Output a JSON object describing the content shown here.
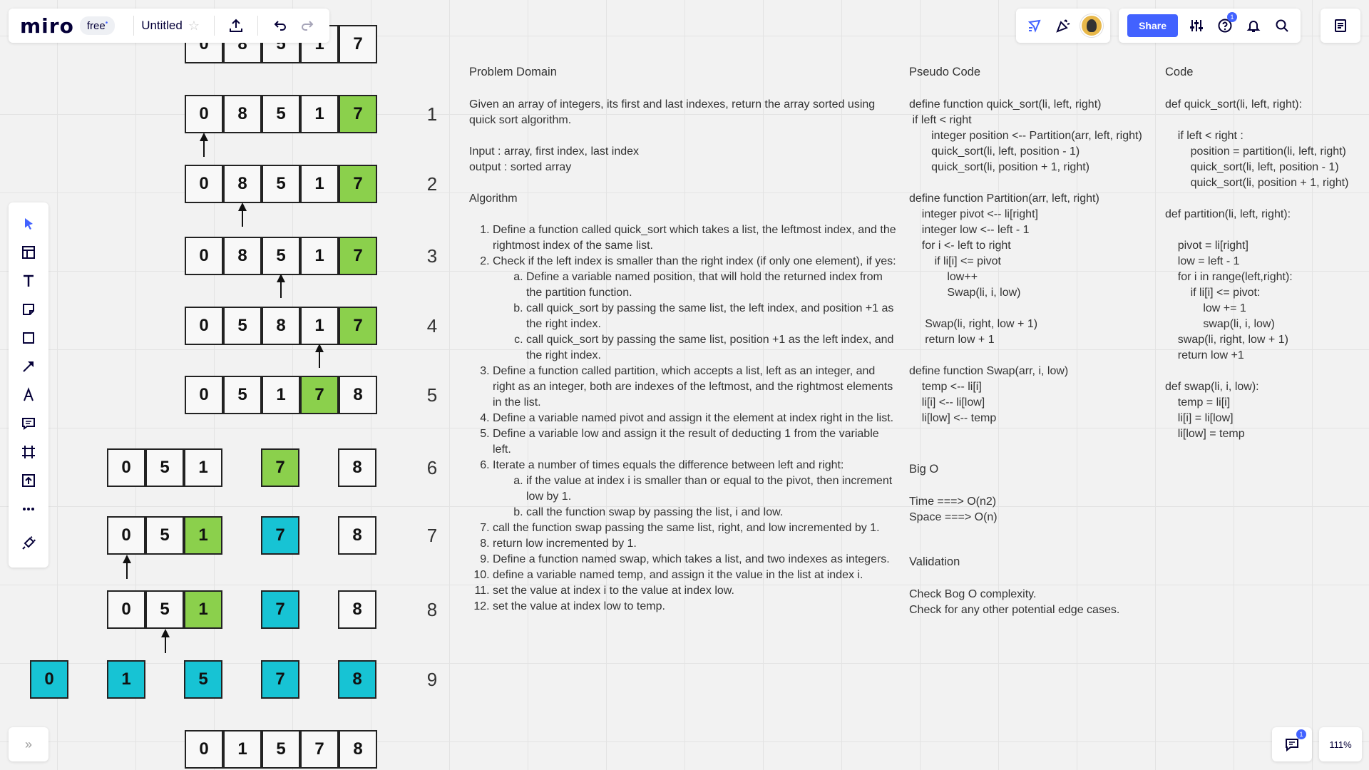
{
  "app": {
    "logo": "miro",
    "plan": "free",
    "plan_marker": "•",
    "board_title": "Untitled",
    "share_label": "Share",
    "help_badge": "1",
    "chat_badge": "1",
    "zoom": "111%"
  },
  "toolbar": {
    "tools": [
      {
        "name": "select-tool",
        "icon": "cursor-icon"
      },
      {
        "name": "templates-tool",
        "icon": "template-icon"
      },
      {
        "name": "text-tool",
        "icon": "text-icon"
      },
      {
        "name": "sticky-note-tool",
        "icon": "sticky-note-icon"
      },
      {
        "name": "shape-tool",
        "icon": "square-icon"
      },
      {
        "name": "connector-tool",
        "icon": "arrow-icon"
      },
      {
        "name": "pen-tool",
        "icon": "pen-icon"
      },
      {
        "name": "comment-tool",
        "icon": "comment-icon"
      },
      {
        "name": "frame-tool",
        "icon": "frame-icon"
      },
      {
        "name": "upload-tool",
        "icon": "upload-icon"
      },
      {
        "name": "more-tool",
        "icon": "more-icon"
      },
      {
        "name": "apps-tool",
        "icon": "plug-icon"
      }
    ]
  },
  "colors": {
    "accent": "#4262ff",
    "pivot_green": "#8bd04c",
    "sorted_cyan": "#17c3d4"
  },
  "diagram": {
    "steps": [
      {
        "label": "",
        "values": [
          "0",
          "8",
          "5",
          "1",
          "7"
        ],
        "highlight": []
      },
      {
        "label": "1",
        "values": [
          "0",
          "8",
          "5",
          "1",
          "7"
        ],
        "highlight": [
          {
            "i": 4,
            "c": "green"
          }
        ]
      },
      {
        "label": "2",
        "values": [
          "0",
          "8",
          "5",
          "1",
          "7"
        ],
        "highlight": [
          {
            "i": 4,
            "c": "green"
          }
        ]
      },
      {
        "label": "3",
        "values": [
          "0",
          "8",
          "5",
          "1",
          "7"
        ],
        "highlight": [
          {
            "i": 4,
            "c": "green"
          }
        ]
      },
      {
        "label": "4",
        "values": [
          "0",
          "5",
          "8",
          "1",
          "7"
        ],
        "highlight": [
          {
            "i": 4,
            "c": "green"
          }
        ]
      },
      {
        "label": "5",
        "values": [
          "0",
          "5",
          "1",
          "7",
          "8"
        ],
        "highlight": [
          {
            "i": 3,
            "c": "green"
          }
        ]
      },
      {
        "label": "6",
        "values": [
          "0",
          "5",
          "1",
          "7",
          "8"
        ],
        "highlight": [
          {
            "i": 3,
            "c": "green"
          }
        ]
      },
      {
        "label": "7",
        "values": [
          "0",
          "5",
          "1",
          "7",
          "8"
        ],
        "highlight": [
          {
            "i": 2,
            "c": "green"
          },
          {
            "i": 3,
            "c": "cyan"
          }
        ]
      },
      {
        "label": "8",
        "values": [
          "0",
          "5",
          "1",
          "7",
          "8"
        ],
        "highlight": [
          {
            "i": 2,
            "c": "green"
          },
          {
            "i": 3,
            "c": "cyan"
          }
        ]
      },
      {
        "label": "9",
        "values": [
          "0",
          "1",
          "5",
          "7",
          "8"
        ],
        "highlight": [
          {
            "i": 0,
            "c": "cyan"
          },
          {
            "i": 1,
            "c": "cyan"
          },
          {
            "i": 2,
            "c": "cyan"
          },
          {
            "i": 3,
            "c": "cyan"
          },
          {
            "i": 4,
            "c": "cyan"
          }
        ]
      },
      {
        "label": "",
        "values": [
          "0",
          "1",
          "5",
          "7",
          "8"
        ],
        "highlight": []
      }
    ]
  },
  "problem": {
    "heading": "Problem Domain",
    "desc": "Given an array of integers, its first and last indexes, return the array sorted using quick sort algorithm.",
    "input": "Input : array, first index, last index",
    "output": "output : sorted array",
    "algorithm_heading": "Algorithm",
    "steps": [
      "Define a function called quick_sort which takes a list, the leftmost index, and the rightmost index of the same list.",
      "Check if the left index is smaller than the right index (if only one element), if yes:",
      "Define a function called partition, which accepts a list, left as an integer, and right as an integer, both are indexes of the leftmost, and the rightmost elements in the list.",
      "Define a variable named pivot and assign it the element at index right in the list.",
      "Define a variable low and assign it the result of deducting 1 from the variable left.",
      "Iterate a number of times equals the difference between left and right:",
      "call the function swap passing the same list, right, and low incremented by 1.",
      "return low incremented by 1.",
      "Define a function named swap, which takes a list, and two indexes as integers.",
      "define a variable named temp, and assign it the value in the list at index i.",
      "set the value at index i to the value at index low.",
      "set the value at index low to temp."
    ],
    "sub2": [
      "Define a variable named position, that will hold the returned index from the partition function.",
      "call quick_sort by passing the same list, the left index, and position +1 as the right index.",
      "call quick_sort by passing the same list, position +1 as the left index, and the right index."
    ],
    "sub6": [
      "if the value at index i is smaller than or equal to the pivot, then increment low by 1.",
      "call the function swap by passing the list, i and low."
    ]
  },
  "pseudo": {
    "heading": "Pseudo Code",
    "lines": [
      "define function quick_sort(li, left, right)",
      " if left < right",
      "       integer position <-- Partition(arr, left, right)",
      "       quick_sort(li, left, position - 1)",
      "       quick_sort(li, position + 1, right)",
      "",
      "define function Partition(arr, left, right)",
      "    integer pivot <-- li[right]",
      "    integer low <-- left - 1",
      "    for i <- left to right",
      "        if li[i] <= pivot",
      "            low++",
      "            Swap(li, i, low)",
      "",
      "     Swap(li, right, low + 1)",
      "     return low + 1",
      "",
      "define function Swap(arr, i, low)",
      "    temp <-- li[i]",
      "    li[i] <-- li[low]",
      "    li[low] <-- temp"
    ],
    "bigo_heading": "Big O",
    "time": "Time ===> O(n2)",
    "space": "Space ===> O(n)",
    "validation_heading": "Validation",
    "val1": "Check Bog O complexity.",
    "val2": "Check for any other potential edge cases."
  },
  "code": {
    "heading": "Code",
    "lines": [
      "def quick_sort(li, left, right):",
      "",
      "    if left < right :",
      "        position = partition(li, left, right)",
      "        quick_sort(li, left, position - 1)",
      "        quick_sort(li, position + 1, right)",
      "",
      "def partition(li, left, right):",
      "",
      "    pivot = li[right]",
      "    low = left - 1",
      "    for i in range(left,right):",
      "        if li[i] <= pivot:",
      "            low += 1",
      "            swap(li, i, low)",
      "    swap(li, right, low + 1)",
      "    return low +1",
      "",
      "def swap(li, i, low):",
      "    temp = li[i]",
      "    li[i] = li[low]",
      "    li[low] = temp"
    ]
  }
}
